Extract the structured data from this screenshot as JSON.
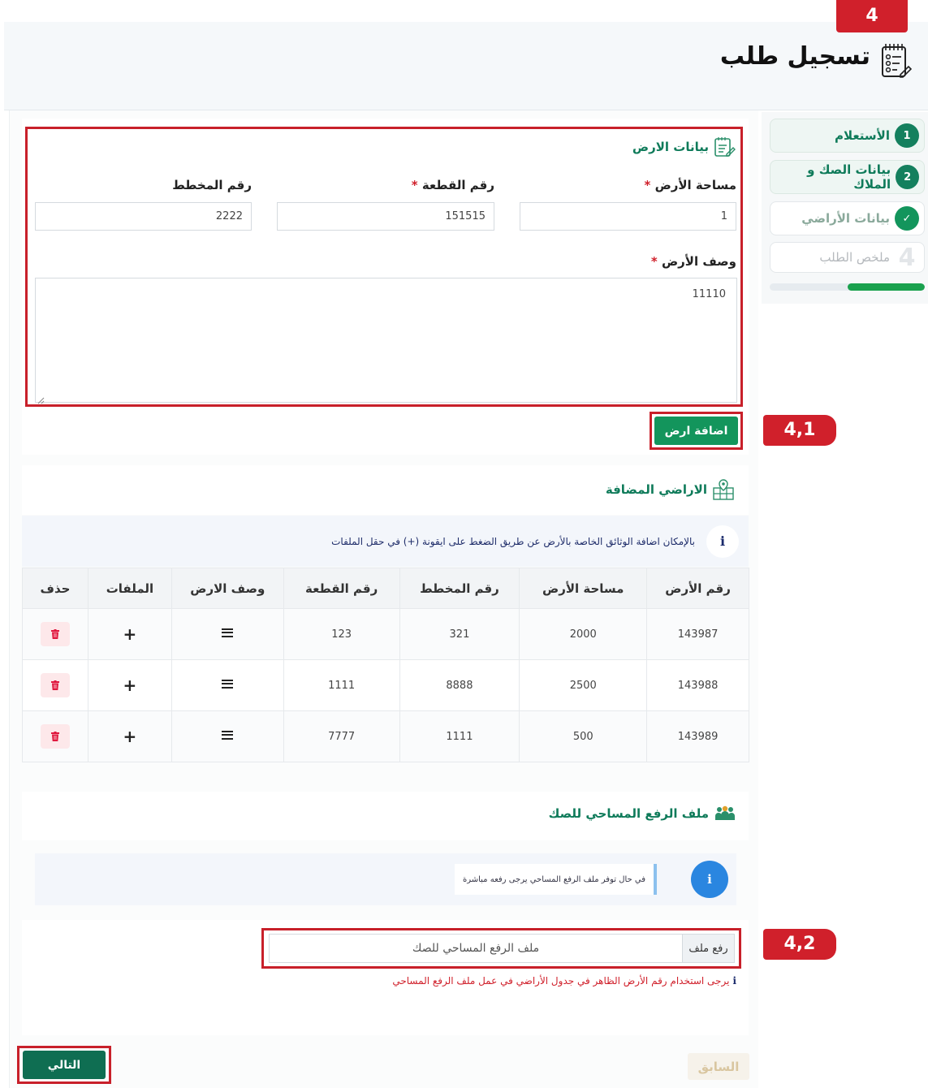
{
  "header": {
    "title": "تسجيل طلب",
    "step_tag": "4"
  },
  "callouts": {
    "add_land": "4,1",
    "upload": "4,2"
  },
  "sidebar": {
    "steps": [
      {
        "num": "1",
        "label": "الأستعلام",
        "state": "done"
      },
      {
        "num": "2",
        "label": "بيانات الصك و الملاك",
        "state": "done"
      },
      {
        "num": "✓",
        "label": "بيانات الأراضي",
        "state": "current"
      },
      {
        "num": "4",
        "label": "ملخص الطلب",
        "state": "pending"
      }
    ],
    "progress": 0.5
  },
  "land_form": {
    "title": "بيانات الارض",
    "area_label": "مساحة الأرض",
    "area_value": "1",
    "plot_label": "رقم القطعة",
    "plot_value": "151515",
    "plan_label": "رقم المخطط",
    "plan_value": "2222",
    "desc_label": "وصف الأرض",
    "desc_value": "11110",
    "required_mark": "*",
    "add_button": "اضافة ارض"
  },
  "added_lands": {
    "title": "الاراضي المضافة",
    "info_text": "بالإمكان اضافة الوثائق الخاصة بالأرض عن طريق الضغط على ايقونة (+) في حقل الملفات",
    "info_icon": "i",
    "columns": [
      "رقم الأرض",
      "مساحة الأرض",
      "رقم المخطط",
      "رقم القطعة",
      "وصف الارض",
      "الملفات",
      "حذف"
    ],
    "rows": [
      {
        "land_no": "143987",
        "area": "2000",
        "plan": "321",
        "plot": "123"
      },
      {
        "land_no": "143988",
        "area": "2500",
        "plan": "8888",
        "plot": "1111"
      },
      {
        "land_no": "143989",
        "area": "500",
        "plan": "1111",
        "plot": "7777"
      }
    ],
    "files_glyph": "+"
  },
  "survey_file": {
    "title": "ملف الرفع المساحي للصك",
    "info_icon": "i",
    "info_text": "في حال توفر ملف الرفع المساحي يرجى رفعه مباشرة",
    "upload_button": "رفع ملف",
    "upload_placeholder": "ملف الرفع المساحي للصك",
    "warning_icon": "i",
    "warning": "يرجى استخدام رقم الأرض الظاهر في جدول الأراضي في عمل ملف الرفع المساحي"
  },
  "nav": {
    "next": "التالي",
    "prev": "السابق"
  },
  "colors": {
    "brand_green": "#13955c",
    "dark_green": "#0f6e52",
    "callout_red": "#d0202b"
  }
}
